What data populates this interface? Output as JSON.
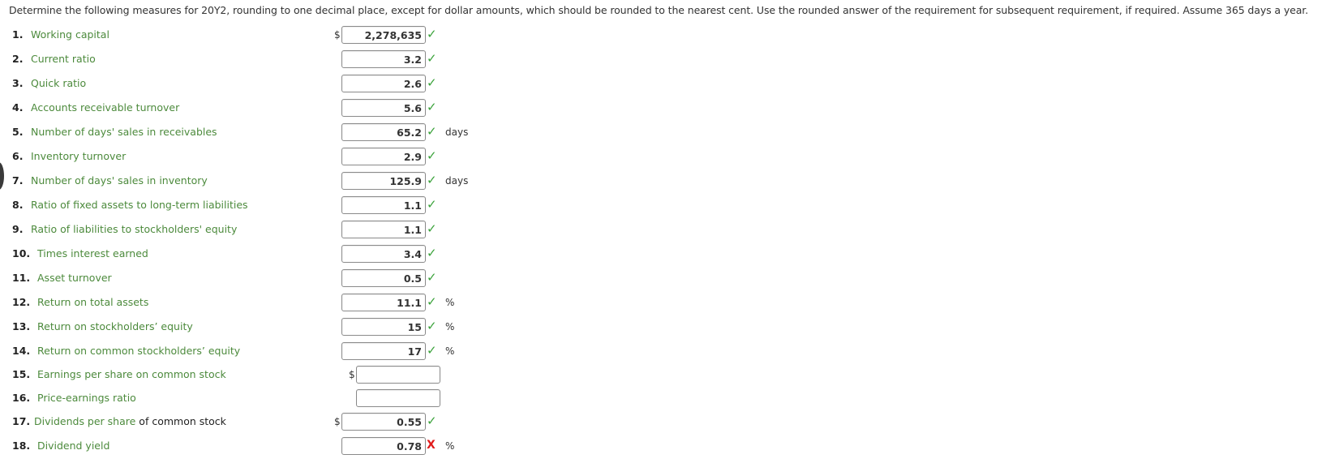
{
  "instructions": "Determine the following measures for 20Y2, rounding to one decimal place, except for dollar amounts, which should be rounded to the nearest cent. Use the rounded answer of the requirement for subsequent requirement, if required. Assume 365 days a year.",
  "items": [
    {
      "num": "1.",
      "label": "Working capital",
      "prefix": "$",
      "value": "2,278,635",
      "status": "correct",
      "status_symbol": "✓",
      "unit": ""
    },
    {
      "num": "2.",
      "label": "Current ratio",
      "prefix": "",
      "value": "3.2",
      "status": "correct",
      "status_symbol": "✓",
      "unit": ""
    },
    {
      "num": "3.",
      "label": "Quick ratio",
      "prefix": "",
      "value": "2.6",
      "status": "correct",
      "status_symbol": "✓",
      "unit": ""
    },
    {
      "num": "4.",
      "label": "Accounts receivable turnover",
      "prefix": "",
      "value": "5.6",
      "status": "correct",
      "status_symbol": "✓",
      "unit": ""
    },
    {
      "num": "5.",
      "label": "Number of days' sales in receivables",
      "prefix": "",
      "value": "65.2",
      "status": "correct",
      "status_symbol": "✓",
      "unit": "days"
    },
    {
      "num": "6.",
      "label": "Inventory turnover",
      "prefix": "",
      "value": "2.9",
      "status": "correct",
      "status_symbol": "✓",
      "unit": ""
    },
    {
      "num": "7.",
      "label": "Number of days' sales in inventory",
      "prefix": "",
      "value": "125.9",
      "status": "correct",
      "status_symbol": "✓",
      "unit": "days"
    },
    {
      "num": "8.",
      "label": "Ratio of fixed assets to long-term liabilities",
      "prefix": "",
      "value": "1.1",
      "status": "correct",
      "status_symbol": "✓",
      "unit": ""
    },
    {
      "num": "9.",
      "label": "Ratio of liabilities to stockholders' equity",
      "prefix": "",
      "value": "1.1",
      "status": "correct",
      "status_symbol": "✓",
      "unit": ""
    },
    {
      "num": "10.",
      "label": "Times interest earned",
      "prefix": "",
      "value": "3.4",
      "status": "correct",
      "status_symbol": "✓",
      "unit": ""
    },
    {
      "num": "11.",
      "label": "Asset turnover",
      "prefix": "",
      "value": "0.5",
      "status": "correct",
      "status_symbol": "✓",
      "unit": ""
    },
    {
      "num": "12.",
      "label": "Return on total assets",
      "prefix": "",
      "value": "11.1",
      "status": "correct",
      "status_symbol": "✓",
      "unit": "%"
    },
    {
      "num": "13.",
      "label": "Return on stockholders’ equity",
      "prefix": "",
      "value": "15",
      "status": "correct",
      "status_symbol": "✓",
      "unit": "%"
    },
    {
      "num": "14.",
      "label": "Return on common stockholders’ equity",
      "prefix": "",
      "value": "17",
      "status": "correct",
      "status_symbol": "✓",
      "unit": "%"
    },
    {
      "num": "15.",
      "label": "Earnings per share on common stock",
      "prefix": "$",
      "value": "",
      "status": "none",
      "status_symbol": "",
      "unit": ""
    },
    {
      "num": "16.",
      "label": "Price-earnings ratio",
      "prefix": "",
      "value": "",
      "status": "none",
      "status_symbol": "",
      "unit": ""
    },
    {
      "num": "17.",
      "label": "Dividends per share",
      "label_suffix": " of common stock",
      "prefix": "$",
      "value": "0.55",
      "status": "correct",
      "status_symbol": "✓",
      "unit": ""
    },
    {
      "num": "18.",
      "label": "Dividend yield",
      "prefix": "",
      "value": "0.78",
      "status": "incorrect",
      "status_symbol": "X",
      "unit": "%"
    }
  ]
}
